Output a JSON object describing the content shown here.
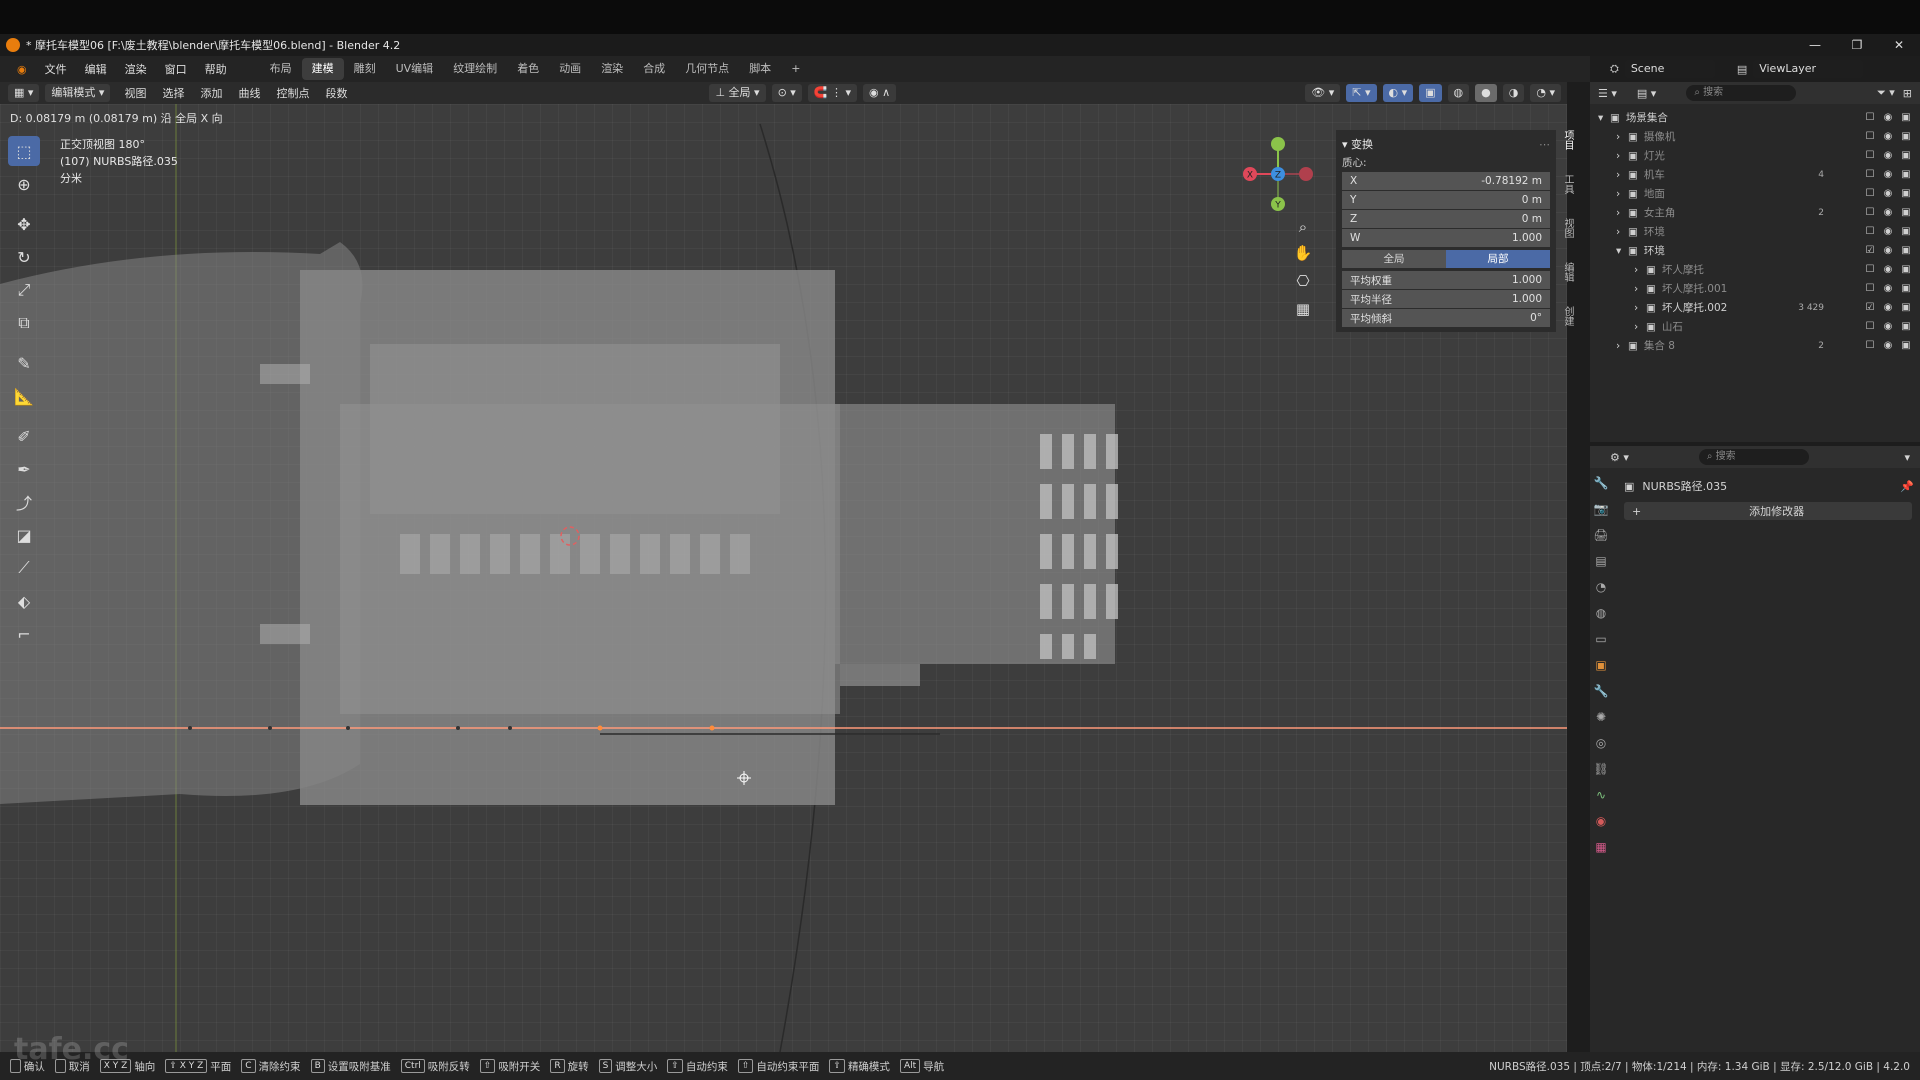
{
  "window": {
    "title": "* 摩托车模型06 [F:\\废土教程\\blender\\摩托车模型06.blend] - Blender 4.2",
    "controls": [
      "—",
      "❐",
      "✕"
    ]
  },
  "menu": {
    "items": [
      "文件",
      "编辑",
      "渲染",
      "窗口",
      "帮助"
    ],
    "workspaces": [
      "布局",
      "建模",
      "雕刻",
      "UV编辑",
      "纹理绘制",
      "着色",
      "动画",
      "渲染",
      "合成",
      "几何节点",
      "脚本",
      "+"
    ],
    "active_workspace": "建模"
  },
  "header": {
    "mode": "编辑模式",
    "items": [
      "视图",
      "选择",
      "添加",
      "曲线",
      "控制点",
      "段数"
    ],
    "orientation": "全局"
  },
  "scene": {
    "scene_name": "Scene",
    "view_layer": "ViewLayer",
    "search_placeholder": "搜索"
  },
  "viewport": {
    "hint": "D: 0.08179 m (0.08179 m) 沿 全局 X 向",
    "view_name": "正交顶视图 180°",
    "object_info": "(107) NURBS路径.035",
    "units": "分米"
  },
  "gizmo": {
    "x": "X",
    "y": "Y",
    "z": "Z"
  },
  "npanel": {
    "section_title": "变换",
    "centroid_label": "质心:",
    "fields": [
      {
        "label": "X",
        "value": "-0.78192 m"
      },
      {
        "label": "Y",
        "value": "0 m"
      },
      {
        "label": "Z",
        "value": "0 m"
      },
      {
        "label": "W",
        "value": "1.000"
      }
    ],
    "toggle": {
      "global": "全局",
      "local": "局部",
      "active": "局部"
    },
    "extras": [
      {
        "label": "平均权重",
        "value": "1.000"
      },
      {
        "label": "平均半径",
        "value": "1.000"
      },
      {
        "label": "平均倾斜",
        "value": "0°"
      }
    ],
    "tabs": [
      "项目",
      "工具",
      "视图",
      "编辑",
      "创建"
    ]
  },
  "outliner": {
    "search_placeholder": "搜索",
    "items": [
      {
        "name": "场景集合",
        "indent": 0,
        "expanded": true,
        "dim": false,
        "badge": ""
      },
      {
        "name": "摄像机",
        "indent": 1,
        "dim": true,
        "badge": ""
      },
      {
        "name": "灯光",
        "indent": 1,
        "dim": true,
        "badge": ""
      },
      {
        "name": "机车",
        "indent": 1,
        "dim": true,
        "badge": "4"
      },
      {
        "name": "地面",
        "indent": 1,
        "dim": true,
        "badge": ""
      },
      {
        "name": "女主角",
        "indent": 1,
        "dim": true,
        "badge": "2"
      },
      {
        "name": "环境",
        "indent": 1,
        "dim": true,
        "badge": ""
      },
      {
        "name": "环境",
        "indent": 1,
        "dim": false,
        "badge": "",
        "expanded": true,
        "checked": true
      },
      {
        "name": "坏人摩托",
        "indent": 2,
        "dim": true,
        "badge": ""
      },
      {
        "name": "坏人摩托.001",
        "indent": 2,
        "dim": true,
        "badge": ""
      },
      {
        "name": "坏人摩托.002",
        "indent": 2,
        "dim": false,
        "badge": "3 429",
        "checked": true
      },
      {
        "name": "山石",
        "indent": 2,
        "dim": true,
        "badge": ""
      },
      {
        "name": "集合 8",
        "indent": 1,
        "dim": true,
        "badge": "2"
      }
    ]
  },
  "properties": {
    "object_name": "NURBS路径.035",
    "add_modifier": "添加修改器"
  },
  "status": {
    "items": [
      {
        "key": "",
        "label": "确认"
      },
      {
        "key": "",
        "label": "取消"
      },
      {
        "key": "X Y Z",
        "label": "轴向"
      },
      {
        "key": "⇧ X Y Z",
        "label": "平面"
      },
      {
        "key": "C",
        "label": "清除约束"
      },
      {
        "key": "B",
        "label": "设置吸附基准"
      },
      {
        "key": "Ctrl",
        "label": "吸附反转"
      },
      {
        "key": "⇧",
        "label": "吸附开关"
      },
      {
        "key": "R",
        "label": "旋转"
      },
      {
        "key": "S",
        "label": "调整大小"
      },
      {
        "key": "⇧",
        "label": "自动约束"
      },
      {
        "key": "⇧",
        "label": "自动约束平面"
      },
      {
        "key": "⇧",
        "label": "精确模式"
      },
      {
        "key": "Alt",
        "label": "导航"
      }
    ],
    "stats": "NURBS路径.035 | 顶点:2/7 | 物体:1/214 | 内存: 1.34 GiB | 显存: 2.5/12.0 GiB | 4.2.0"
  },
  "watermark": "tafe.cc",
  "colors": {
    "accent": "#4b6aa6",
    "x_axis": "#e0485a",
    "y_axis": "#8bc34a",
    "z_axis": "#3d8fe0",
    "curve": "#ff9a7a"
  }
}
